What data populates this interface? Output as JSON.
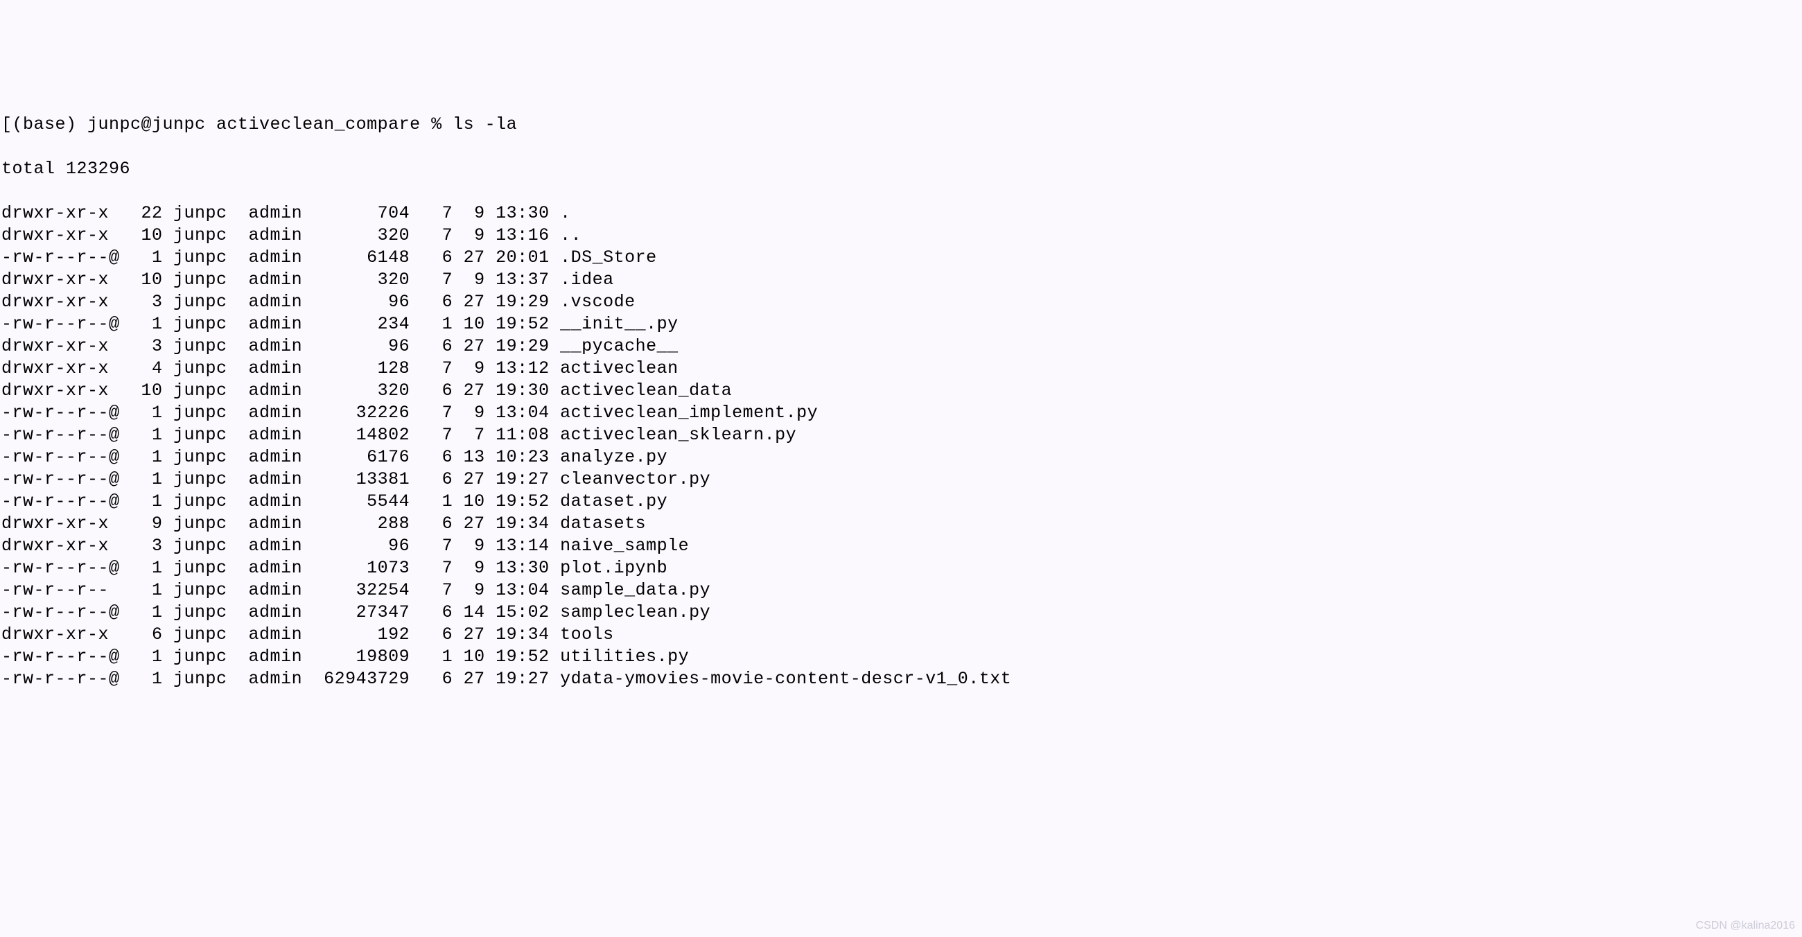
{
  "prompt": "[(base) junpc@junpc activeclean_compare % ls -la",
  "total_line": "total 123296",
  "rows": [
    {
      "perm": "drwxr-xr-x ",
      "links": "22",
      "owner": "junpc",
      "group": "admin",
      "size": "     704",
      "mon": " 7",
      "day": " 9",
      "time": "13:30",
      "name": "."
    },
    {
      "perm": "drwxr-xr-x ",
      "links": "10",
      "owner": "junpc",
      "group": "admin",
      "size": "     320",
      "mon": " 7",
      "day": " 9",
      "time": "13:16",
      "name": ".."
    },
    {
      "perm": "-rw-r--r--@",
      "links": " 1",
      "owner": "junpc",
      "group": "admin",
      "size": "    6148",
      "mon": " 6",
      "day": "27",
      "time": "20:01",
      "name": ".DS_Store"
    },
    {
      "perm": "drwxr-xr-x ",
      "links": "10",
      "owner": "junpc",
      "group": "admin",
      "size": "     320",
      "mon": " 7",
      "day": " 9",
      "time": "13:37",
      "name": ".idea"
    },
    {
      "perm": "drwxr-xr-x ",
      "links": " 3",
      "owner": "junpc",
      "group": "admin",
      "size": "      96",
      "mon": " 6",
      "day": "27",
      "time": "19:29",
      "name": ".vscode"
    },
    {
      "perm": "-rw-r--r--@",
      "links": " 1",
      "owner": "junpc",
      "group": "admin",
      "size": "     234",
      "mon": " 1",
      "day": "10",
      "time": "19:52",
      "name": "__init__.py"
    },
    {
      "perm": "drwxr-xr-x ",
      "links": " 3",
      "owner": "junpc",
      "group": "admin",
      "size": "      96",
      "mon": " 6",
      "day": "27",
      "time": "19:29",
      "name": "__pycache__"
    },
    {
      "perm": "drwxr-xr-x ",
      "links": " 4",
      "owner": "junpc",
      "group": "admin",
      "size": "     128",
      "mon": " 7",
      "day": " 9",
      "time": "13:12",
      "name": "activeclean"
    },
    {
      "perm": "drwxr-xr-x ",
      "links": "10",
      "owner": "junpc",
      "group": "admin",
      "size": "     320",
      "mon": " 6",
      "day": "27",
      "time": "19:30",
      "name": "activeclean_data"
    },
    {
      "perm": "-rw-r--r--@",
      "links": " 1",
      "owner": "junpc",
      "group": "admin",
      "size": "   32226",
      "mon": " 7",
      "day": " 9",
      "time": "13:04",
      "name": "activeclean_implement.py"
    },
    {
      "perm": "-rw-r--r--@",
      "links": " 1",
      "owner": "junpc",
      "group": "admin",
      "size": "   14802",
      "mon": " 7",
      "day": " 7",
      "time": "11:08",
      "name": "activeclean_sklearn.py"
    },
    {
      "perm": "-rw-r--r--@",
      "links": " 1",
      "owner": "junpc",
      "group": "admin",
      "size": "    6176",
      "mon": " 6",
      "day": "13",
      "time": "10:23",
      "name": "analyze.py"
    },
    {
      "perm": "-rw-r--r--@",
      "links": " 1",
      "owner": "junpc",
      "group": "admin",
      "size": "   13381",
      "mon": " 6",
      "day": "27",
      "time": "19:27",
      "name": "cleanvector.py"
    },
    {
      "perm": "-rw-r--r--@",
      "links": " 1",
      "owner": "junpc",
      "group": "admin",
      "size": "    5544",
      "mon": " 1",
      "day": "10",
      "time": "19:52",
      "name": "dataset.py"
    },
    {
      "perm": "drwxr-xr-x ",
      "links": " 9",
      "owner": "junpc",
      "group": "admin",
      "size": "     288",
      "mon": " 6",
      "day": "27",
      "time": "19:34",
      "name": "datasets"
    },
    {
      "perm": "drwxr-xr-x ",
      "links": " 3",
      "owner": "junpc",
      "group": "admin",
      "size": "      96",
      "mon": " 7",
      "day": " 9",
      "time": "13:14",
      "name": "naive_sample"
    },
    {
      "perm": "-rw-r--r--@",
      "links": " 1",
      "owner": "junpc",
      "group": "admin",
      "size": "    1073",
      "mon": " 7",
      "day": " 9",
      "time": "13:30",
      "name": "plot.ipynb"
    },
    {
      "perm": "-rw-r--r-- ",
      "links": " 1",
      "owner": "junpc",
      "group": "admin",
      "size": "   32254",
      "mon": " 7",
      "day": " 9",
      "time": "13:04",
      "name": "sample_data.py"
    },
    {
      "perm": "-rw-r--r--@",
      "links": " 1",
      "owner": "junpc",
      "group": "admin",
      "size": "   27347",
      "mon": " 6",
      "day": "14",
      "time": "15:02",
      "name": "sampleclean.py"
    },
    {
      "perm": "drwxr-xr-x ",
      "links": " 6",
      "owner": "junpc",
      "group": "admin",
      "size": "     192",
      "mon": " 6",
      "day": "27",
      "time": "19:34",
      "name": "tools"
    },
    {
      "perm": "-rw-r--r--@",
      "links": " 1",
      "owner": "junpc",
      "group": "admin",
      "size": "   19809",
      "mon": " 1",
      "day": "10",
      "time": "19:52",
      "name": "utilities.py"
    },
    {
      "perm": "-rw-r--r--@",
      "links": " 1",
      "owner": "junpc",
      "group": "admin",
      "size": "62943729",
      "mon": " 6",
      "day": "27",
      "time": "19:27",
      "name": "ydata-ymovies-movie-content-descr-v1_0.txt"
    }
  ],
  "watermark": "CSDN @kalina2016"
}
